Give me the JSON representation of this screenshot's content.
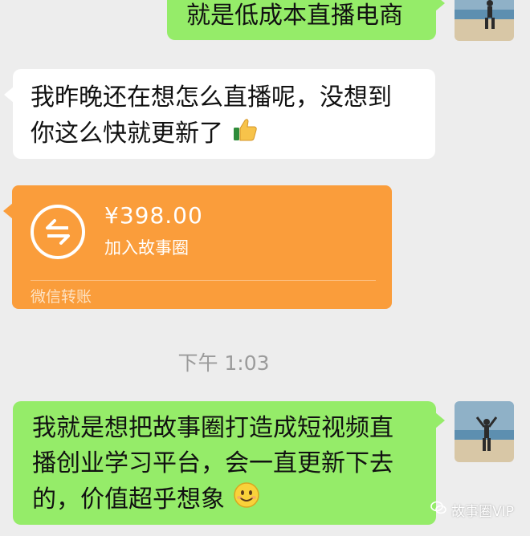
{
  "messages": {
    "m1": "就是低成本直播电商",
    "m2_line1": "我昨晚还在想怎么直播呢，没想到",
    "m2_line2": "你这么快就更新了",
    "m3_line1": "我就是想把故事圈打造成短视频直",
    "m3_line2": "播创业学习平台，会一直更新下去",
    "m3_line3": "的，价值超乎想象"
  },
  "transfer": {
    "amount": "¥398.00",
    "note": "加入故事圈",
    "footer": "微信转账"
  },
  "timestamp": "下午 1:03",
  "watermark": "故事圈VIP",
  "icons": [
    "thumbs-up-emoji",
    "smile-emoji",
    "transfer-arrows-icon",
    "wechat-channel-icon"
  ],
  "colors": {
    "background": "#ededed",
    "sent_bubble": "#95ec69",
    "received_bubble": "#ffffff",
    "transfer_bubble": "#fa9d3b",
    "timestamp": "#9b9b9b"
  }
}
